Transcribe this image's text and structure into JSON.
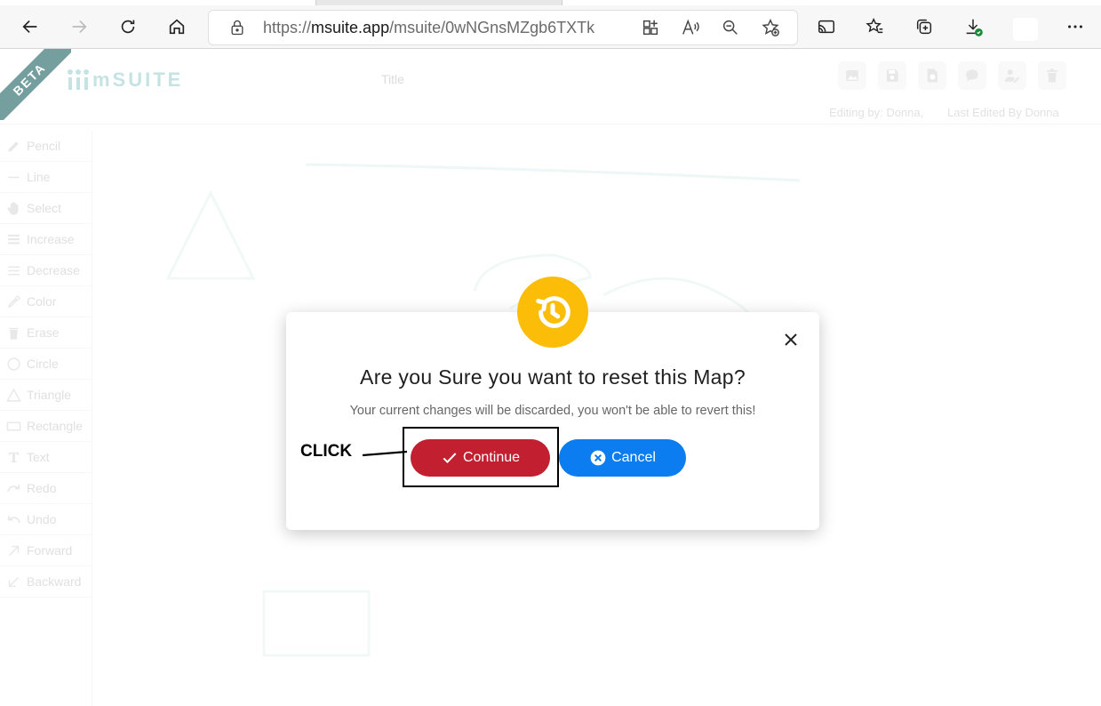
{
  "browser": {
    "url_host": "msuite.app",
    "url_path": "/msuite/0wNGnsMZgb6TXTk",
    "buttons": {
      "back": "back-arrow-icon",
      "forward": "forward-arrow-icon",
      "refresh": "refresh-icon",
      "home": "home-icon",
      "apps": "apps-icon",
      "read_aloud": "read-aloud-icon",
      "zoom": "zoom-out-icon",
      "favorite_add": "add-favorite-icon",
      "cast": "cast-icon",
      "favorites": "favorites-icon",
      "collections": "collections-icon",
      "downloads": "downloads-icon",
      "more": "more-icon"
    }
  },
  "app": {
    "beta_ribbon": "BETA",
    "logo_text": "mSUITE",
    "doc_title_placeholder": "Title",
    "editing_by": "Editing by: Donna,",
    "last_edited_by": "Last Edited By Donna",
    "header_icons": [
      "image-icon",
      "save-icon",
      "reset-icon",
      "comment-icon",
      "share-user-icon",
      "delete-icon"
    ]
  },
  "sidebar": {
    "items": [
      {
        "label": "Pencil",
        "icon": "pencil-icon"
      },
      {
        "label": "Line",
        "icon": "line-icon"
      },
      {
        "label": "Select",
        "icon": "hand-icon"
      },
      {
        "label": "Increase",
        "icon": "increase-icon"
      },
      {
        "label": "Decrease",
        "icon": "decrease-icon"
      },
      {
        "label": "Color",
        "icon": "eyedropper-icon"
      },
      {
        "label": "Erase",
        "icon": "trash-icon"
      },
      {
        "label": "Circle",
        "icon": "circle-icon"
      },
      {
        "label": "Triangle",
        "icon": "triangle-icon"
      },
      {
        "label": "Rectangle",
        "icon": "rectangle-icon"
      },
      {
        "label": "Text",
        "icon": "text-icon"
      },
      {
        "label": "Redo",
        "icon": "redo-icon"
      },
      {
        "label": "Undo",
        "icon": "undo-icon"
      },
      {
        "label": "Forward",
        "icon": "forward-icon"
      },
      {
        "label": "Backward",
        "icon": "backward-icon"
      }
    ]
  },
  "modal": {
    "icon": "history-icon",
    "title": "Are you Sure you want to reset this Map?",
    "text": "Your current changes will be discarded, you won't be able to revert this!",
    "continue_label": "Continue",
    "cancel_label": "Cancel",
    "annotation_label": "CLICK"
  },
  "colors": {
    "continue": "#c21f30",
    "cancel": "#0b7df0",
    "badge": "#fbbd08",
    "beta": "#2b6b6b"
  }
}
